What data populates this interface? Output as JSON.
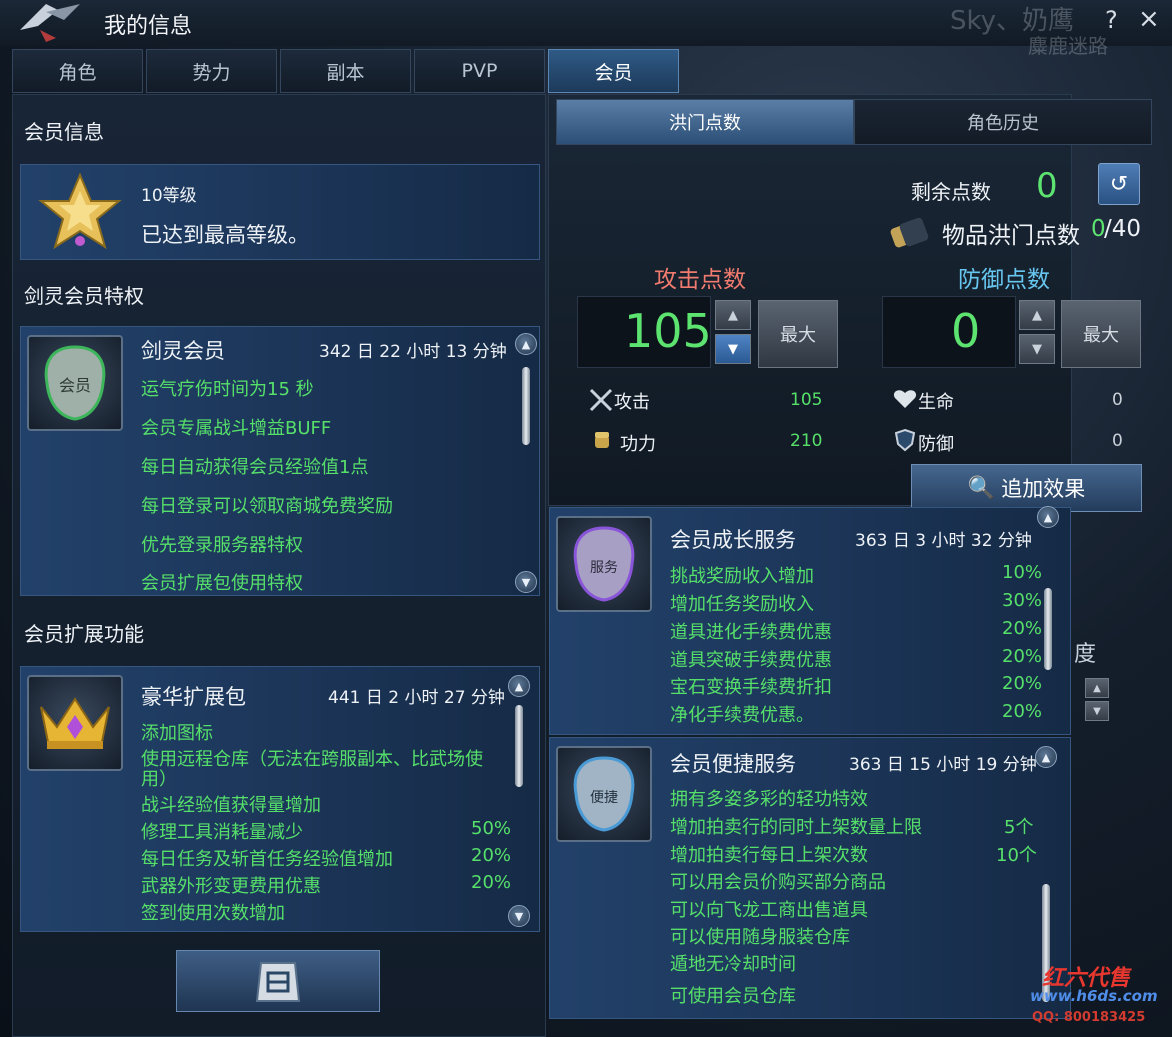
{
  "window": {
    "title": "我的信息",
    "help": "?",
    "close": "×",
    "bg_text_1": "Sky、奶鹰",
    "bg_text_2": "麋鹿迷路"
  },
  "tabs": [
    "角色",
    "势力",
    "副本",
    "PVP",
    "会员"
  ],
  "left": {
    "member_info_title": "会员信息",
    "level": "10等级",
    "level_desc": "已达到最高等级。",
    "privilege_title": "剑灵会员特权",
    "vip": {
      "name": "剑灵会员",
      "time": "342 日 22 小时 13 分钟",
      "perks": [
        "运气疗伤时间为15 秒",
        "会员专属战斗增益BUFF",
        "每日自动获得会员经验值1点",
        "每日登录可以领取商城免费奖励",
        "优先登录服务器特权",
        "会员扩展包使用特权"
      ]
    },
    "expansion_title": "会员扩展功能",
    "deluxe": {
      "name": "豪华扩展包",
      "time": "441 日 2 小时 27 分钟",
      "perks": [
        {
          "text": "添加图标",
          "value": ""
        },
        {
          "text": "使用远程仓库（无法在跨服副本、比武场使",
          "value": ""
        },
        {
          "text": "用）",
          "value": ""
        },
        {
          "text": "战斗经验值获得量增加",
          "value": ""
        },
        {
          "text": "修理工具消耗量减少",
          "value": "50%"
        },
        {
          "text": "每日任务及斩首任务经验值增加",
          "value": "20%"
        },
        {
          "text": "武器外形变更费用优惠",
          "value": "20%"
        },
        {
          "text": "签到使用次数增加",
          "value": ""
        }
      ]
    }
  },
  "right": {
    "subtabs": [
      "洪门点数",
      "角色历史"
    ],
    "remaining_label": "剩余点数",
    "remaining_value": "0",
    "item_points_label": "物品洪门点数",
    "item_points_current": "0",
    "item_points_max": "/40",
    "attack_label": "攻击点数",
    "defense_label": "防御点数",
    "attack_value": "105",
    "defense_value": "0",
    "max_label": "最大",
    "stats": {
      "attack": {
        "label": "攻击",
        "value": "105"
      },
      "power": {
        "label": "功力",
        "value": "210"
      },
      "life": {
        "label": "生命",
        "value": "0"
      },
      "defense": {
        "label": "防御",
        "value": "0"
      }
    },
    "add_effect": "追加效果"
  },
  "growth": {
    "name": "会员成长服务",
    "time": "363 日 3 小时 32 分钟",
    "rows": [
      {
        "text": "挑战奖励收入增加",
        "value": "10%"
      },
      {
        "text": "增加任务奖励收入",
        "value": "30%"
      },
      {
        "text": "道具进化手续费优惠",
        "value": "20%"
      },
      {
        "text": "道具突破手续费优惠",
        "value": "20%"
      },
      {
        "text": "宝石变换手续费折扣",
        "value": "20%"
      },
      {
        "text": "净化手续费优惠。",
        "value": "20%"
      }
    ]
  },
  "convenience": {
    "name": "会员便捷服务",
    "time": "363 日 15 小时 19 分钟",
    "rows": [
      {
        "text": "拥有多姿多彩的轻功特效",
        "value": ""
      },
      {
        "text": "增加拍卖行的同时上架数量上限",
        "value": "5个"
      },
      {
        "text": "增加拍卖行每日上架次数",
        "value": "10个"
      },
      {
        "text": "可以用会员价购买部分商品",
        "value": ""
      },
      {
        "text": "可以向飞龙工商出售道具",
        "value": ""
      },
      {
        "text": "可以使用随身服装仓库",
        "value": ""
      },
      {
        "text": "遁地无冷却时间",
        "value": ""
      },
      {
        "text": "可使用会员仓库",
        "value": ""
      }
    ]
  },
  "side": {
    "label": "度"
  },
  "watermark": {
    "name": "红六代售",
    "url": "www.h6ds.com",
    "qq": "QQ: 800183425"
  }
}
